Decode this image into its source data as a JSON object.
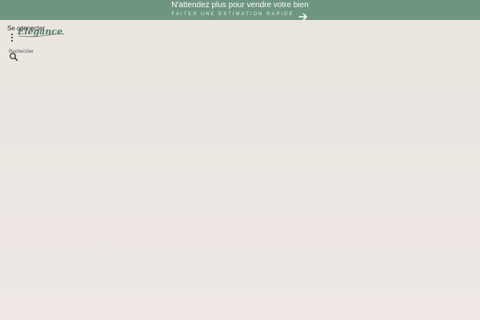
{
  "promo": {
    "title": "N'attendez plus pour vendre votre bien",
    "cta_label": "FAITES UNE ESTIMATION RAPIDE",
    "background_color": "#6d9580"
  },
  "header": {
    "login_label": "Se connecter",
    "logo_text": "Élégance",
    "search_label": "Rechercher",
    "menu_icon": "vertical-dots-icon",
    "search_icon": "search-icon"
  },
  "colors": {
    "page_background": "#ece5e0",
    "accent_green": "#6d9580"
  }
}
